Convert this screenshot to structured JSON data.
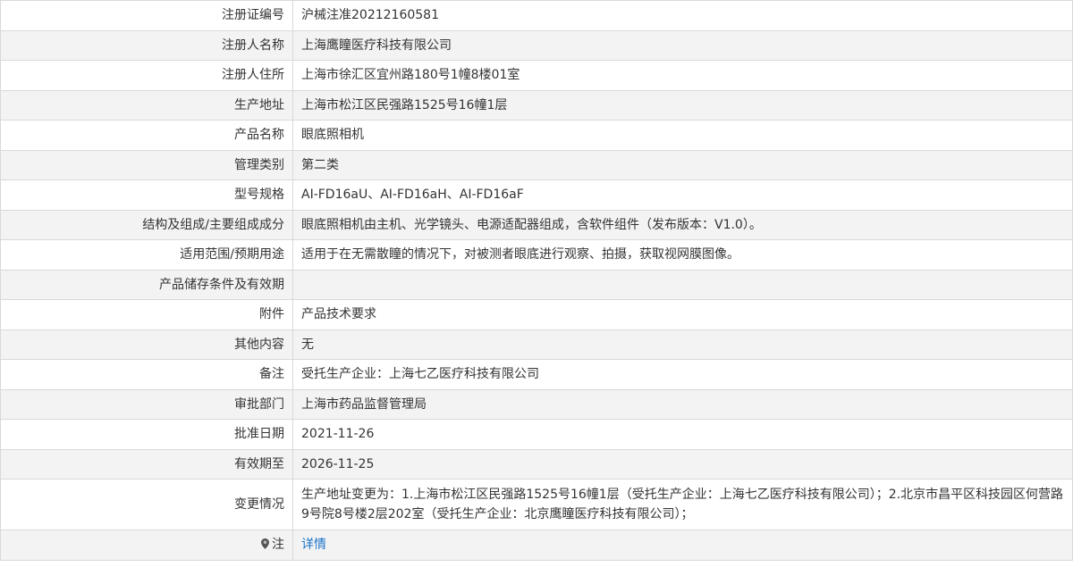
{
  "rows": [
    {
      "label": "注册证编号",
      "value": "沪械注准20212160581"
    },
    {
      "label": "注册人名称",
      "value": "上海鹰瞳医疗科技有限公司"
    },
    {
      "label": "注册人住所",
      "value": "上海市徐汇区宜州路180号1幢8楼01室"
    },
    {
      "label": "生产地址",
      "value": "上海市松江区民强路1525号16幢1层"
    },
    {
      "label": "产品名称",
      "value": "眼底照相机"
    },
    {
      "label": "管理类别",
      "value": "第二类"
    },
    {
      "label": "型号规格",
      "value": "AI-FD16aU、AI-FD16aH、AI-FD16aF"
    },
    {
      "label": "结构及组成/主要组成成分",
      "value": "眼底照相机由主机、光学镜头、电源适配器组成，含软件组件（发布版本：V1.0）。"
    },
    {
      "label": "适用范围/预期用途",
      "value": "适用于在无需散瞳的情况下，对被测者眼底进行观察、拍摄，获取视网膜图像。"
    },
    {
      "label": "产品储存条件及有效期",
      "value": ""
    },
    {
      "label": "附件",
      "value": "产品技术要求"
    },
    {
      "label": "其他内容",
      "value": "无"
    },
    {
      "label": "备注",
      "value": "受托生产企业：上海七乙医疗科技有限公司"
    },
    {
      "label": "审批部门",
      "value": "上海市药品监督管理局"
    },
    {
      "label": "批准日期",
      "value": "2021-11-26"
    },
    {
      "label": "有效期至",
      "value": "2026-11-25"
    },
    {
      "label": "变更情况",
      "value": "生产地址变更为：1.上海市松江区民强路1525号16幢1层（受托生产企业：上海七乙医疗科技有限公司）；2.北京市昌平区科技园区何营路9号院8号楼2层202室（受托生产企业：北京鹰瞳医疗科技有限公司）；"
    }
  ],
  "note_row": {
    "label": "注",
    "icon": "pin-icon",
    "link_text": "详情"
  },
  "colors": {
    "row_alt": "#f3f3f3",
    "border": "#d9d9d9",
    "text": "#333333",
    "link": "#1a73c9"
  }
}
